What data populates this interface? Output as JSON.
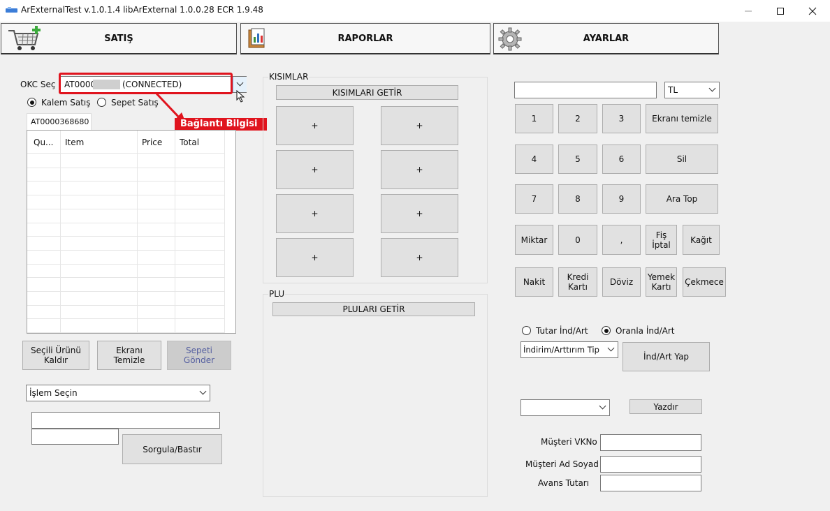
{
  "window": {
    "title": "ArExternalTest v.1.0.1.4 libArExternal 1.0.0.28 ECR 1.9.48",
    "minimize_icon": "minimize-icon",
    "maximize_icon": "maximize-icon",
    "close_icon": "close-icon"
  },
  "top_tabs": [
    {
      "label": "SATIŞ",
      "icon": "shopping-cart-icon"
    },
    {
      "label": "RAPORLAR",
      "icon": "report-book-icon"
    },
    {
      "label": "AYARLAR",
      "icon": "gear-icon"
    }
  ],
  "okc": {
    "label": "OKC Seç",
    "value_prefix": "AT0000",
    "value_suffix": "(CONNECTED)",
    "annotation": "Bağlantı Bilgisi",
    "annotation_color": "#e0141e"
  },
  "sale_mode": {
    "option1": "Kalem Satış",
    "option2": "Sepet Satış",
    "selected": "Kalem Satış"
  },
  "device_tab": "AT0000368680",
  "table": {
    "columns": [
      "Qu...",
      "Item",
      "Price",
      "Total"
    ],
    "rows": []
  },
  "left_buttons": {
    "remove_line1": "Seçili Ürünü",
    "remove_line2": "Kaldır",
    "clear_line1": "Ekranı",
    "clear_line2": "Temizle",
    "send_line1": "Sepeti",
    "send_line2": "Gönder"
  },
  "operation_select": "İşlem Seçin",
  "query_button": "Sorgula/Bastır",
  "sections": {
    "title": "KISIMLAR",
    "fetch_button": "KISIMLARI GETİR",
    "buttons": [
      "+",
      "+",
      "+",
      "+",
      "+",
      "+",
      "+",
      "+"
    ]
  },
  "plu": {
    "title": "PLU",
    "fetch_button": "PLULARI GETİR"
  },
  "currency": "TL",
  "keypad": {
    "k1": "1",
    "k2": "2",
    "k3": "3",
    "clear": "Ekranı temizle",
    "k4": "4",
    "k5": "5",
    "k6": "6",
    "delete": "Sil",
    "k7": "7",
    "k8": "8",
    "k9": "9",
    "subtotal": "Ara Top",
    "quantity": "Miktar",
    "k0": "0",
    "comma": ",",
    "receipt_cancel1": "Fiş",
    "receipt_cancel2": "İptal",
    "paper": "Kağıt",
    "cash": "Nakit",
    "credit1": "Kredi",
    "credit2": "Kartı",
    "fx": "Döviz",
    "meal1": "Yemek",
    "meal2": "Kartı",
    "drawer": "Çekmece"
  },
  "discount": {
    "amount_option": "Tutar İnd/Art",
    "rate_option": "Oranla İnd/Art",
    "selected": "Oranla İnd/Art",
    "type_select": "İndirim/Arttırım Tip",
    "apply_button": "İnd/Art Yap"
  },
  "print_button": "Yazdır",
  "customer": {
    "tax_label": "Müşteri VKNo",
    "name_label": "Müşteri Ad Soyad",
    "advance_label": "Avans Tutarı"
  }
}
